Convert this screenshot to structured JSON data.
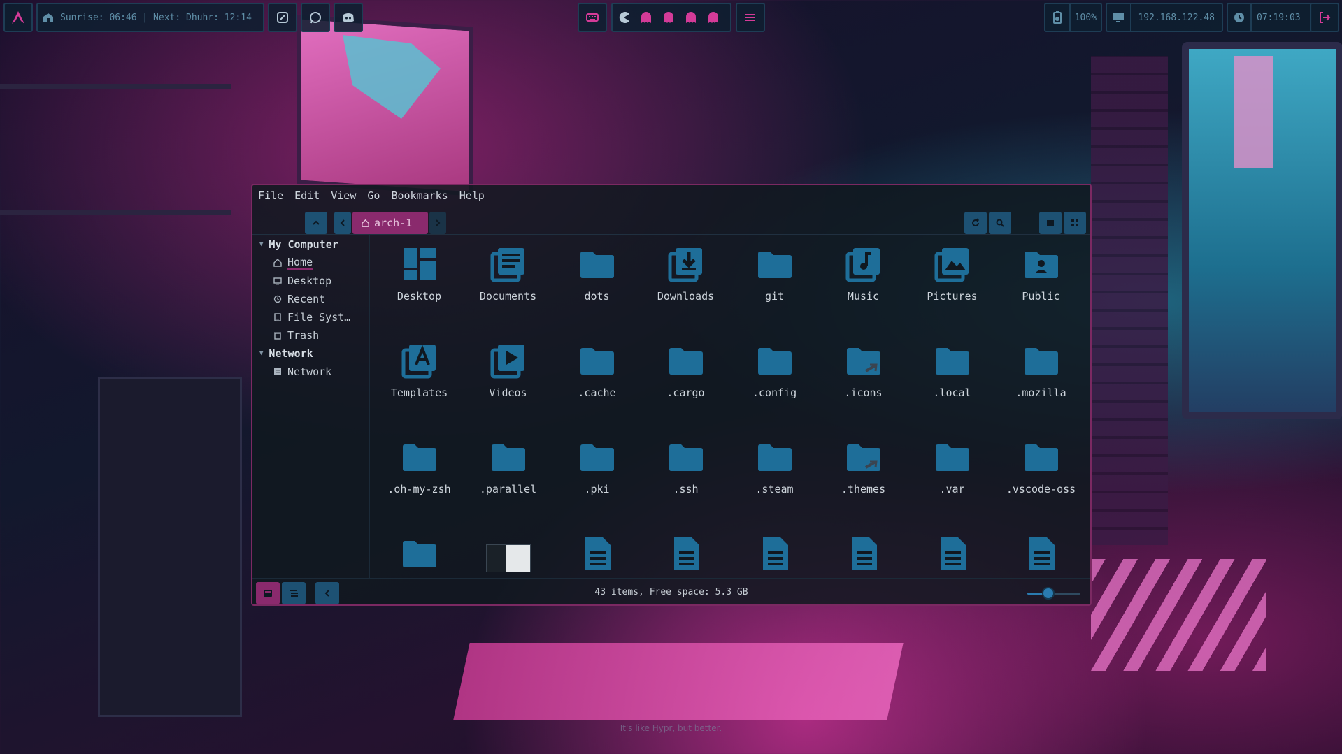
{
  "topbar": {
    "prayer": "Sunrise: 06:46 | Next: Dhuhr: 12:14",
    "battery": "100%",
    "ip": "192.168.122.48",
    "clock": "07:19:03"
  },
  "menu": [
    "File",
    "Edit",
    "View",
    "Go",
    "Bookmarks",
    "Help"
  ],
  "location": "arch-1",
  "sidebar": {
    "groups": [
      {
        "title": "My Computer",
        "items": [
          {
            "label": "Home",
            "icon": "home-icon",
            "active": true
          },
          {
            "label": "Desktop",
            "icon": "desktop-icon"
          },
          {
            "label": "Recent",
            "icon": "history-icon"
          },
          {
            "label": "File Syst…",
            "icon": "drive-icon"
          },
          {
            "label": "Trash",
            "icon": "trash-icon"
          }
        ]
      },
      {
        "title": "Network",
        "items": [
          {
            "label": "Network",
            "icon": "network-icon"
          }
        ]
      }
    ]
  },
  "files": [
    {
      "name": "Desktop",
      "icon": "desktop-folder-icon"
    },
    {
      "name": "Documents",
      "icon": "documents-folder-icon"
    },
    {
      "name": "dots",
      "icon": "folder-icon"
    },
    {
      "name": "Downloads",
      "icon": "downloads-folder-icon"
    },
    {
      "name": "git",
      "icon": "folder-icon"
    },
    {
      "name": "Music",
      "icon": "music-folder-icon"
    },
    {
      "name": "Pictures",
      "icon": "pictures-folder-icon"
    },
    {
      "name": "Public",
      "icon": "public-folder-icon"
    },
    {
      "name": "Templates",
      "icon": "templates-folder-icon"
    },
    {
      "name": "Videos",
      "icon": "videos-folder-icon"
    },
    {
      "name": ".cache",
      "icon": "folder-icon"
    },
    {
      "name": ".cargo",
      "icon": "folder-icon"
    },
    {
      "name": ".config",
      "icon": "folder-icon"
    },
    {
      "name": ".icons",
      "icon": "folder-link-icon"
    },
    {
      "name": ".local",
      "icon": "folder-icon"
    },
    {
      "name": ".mozilla",
      "icon": "folder-icon"
    },
    {
      "name": ".oh-my-zsh",
      "icon": "folder-icon"
    },
    {
      "name": ".parallel",
      "icon": "folder-icon"
    },
    {
      "name": ".pki",
      "icon": "folder-icon"
    },
    {
      "name": ".ssh",
      "icon": "folder-icon"
    },
    {
      "name": ".steam",
      "icon": "folder-icon"
    },
    {
      "name": ".themes",
      "icon": "folder-link-icon"
    },
    {
      "name": ".var",
      "icon": "folder-icon"
    },
    {
      "name": ".vscode-oss",
      "icon": "folder-icon"
    },
    {
      "name": "",
      "icon": "folder-icon"
    },
    {
      "name": "",
      "icon": "image-thumbnail-icon"
    },
    {
      "name": "",
      "icon": "file-icon"
    },
    {
      "name": "",
      "icon": "file-icon"
    },
    {
      "name": "",
      "icon": "file-icon"
    },
    {
      "name": "",
      "icon": "file-icon"
    },
    {
      "name": "",
      "icon": "file-icon"
    },
    {
      "name": "",
      "icon": "file-icon"
    }
  ],
  "status": "43 items, Free space: 5.3 GB",
  "zoom_level": 0.4,
  "desktop_caption": "It's like Hypr, but better.",
  "colors": {
    "accent_magenta": "#8a2a6d",
    "accent_blue": "#1d5173",
    "icon_blue": "#1e6e99"
  }
}
